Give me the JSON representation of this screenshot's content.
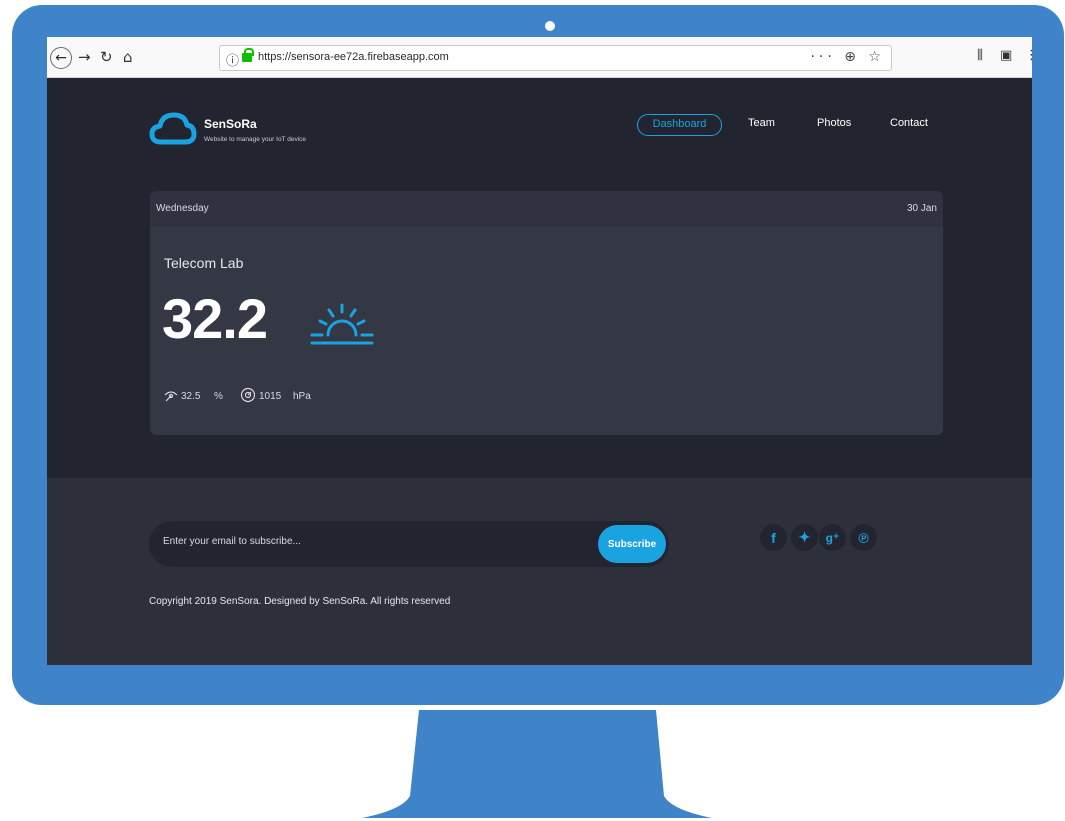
{
  "browser": {
    "url": "https://sensora-ee72a.firebaseapp.com",
    "info_icon": "info-icon",
    "page_actions": "··· ⊕ ☆"
  },
  "header": {
    "brand": "SenSoRa",
    "tagline": "Website to manage your IoT device",
    "nav": [
      {
        "label": "Dashboard"
      },
      {
        "label": "Team"
      },
      {
        "label": "Photos"
      },
      {
        "label": "Contact"
      }
    ]
  },
  "weather": {
    "day": "Wednesday",
    "date": "30 Jan",
    "location": "Telecom Lab",
    "temperature": "32.2",
    "humidity": "32.5",
    "humidity_unit": "%",
    "pressure": "1015",
    "pressure_unit": "hPa"
  },
  "footer": {
    "email_placeholder": "Enter your email to subscribe...",
    "subscribe_label": "Subscribe",
    "social": [
      {
        "icon": "facebook-icon",
        "glyph": "f"
      },
      {
        "icon": "twitter-icon",
        "glyph": "✦"
      },
      {
        "icon": "google-plus-icon",
        "glyph": "g⁺"
      },
      {
        "icon": "pinterest-icon",
        "glyph": "℗"
      }
    ],
    "copyright": "Copyright 2019 SenSora. Designed by SenSoRa. All rights reserved"
  },
  "colors": {
    "accent": "#1aa3e1",
    "monitor": "#3f84c9",
    "page_bg": "#22252f",
    "card_bg": "#343744"
  }
}
